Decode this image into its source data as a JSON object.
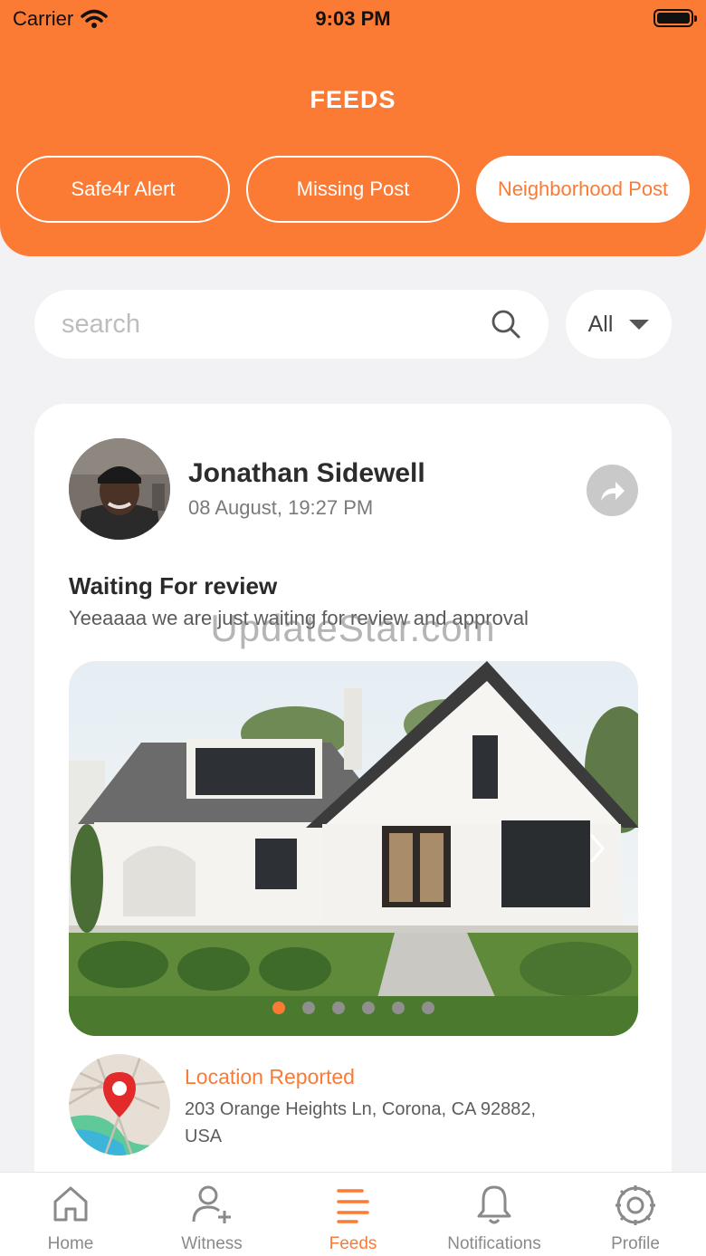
{
  "status_bar": {
    "carrier": "Carrier",
    "time": "9:03 PM"
  },
  "header": {
    "title": "FEEDS"
  },
  "tabs": [
    {
      "label": "Safe4r Alert",
      "active": false
    },
    {
      "label": "Missing Post",
      "active": false
    },
    {
      "label": "Neighborhood Post",
      "active": true
    }
  ],
  "search": {
    "placeholder": "search"
  },
  "filter": {
    "selected": "All"
  },
  "post": {
    "author": "Jonathan Sidewell",
    "date": "08 August, 19:27 PM",
    "title": "Waiting For review",
    "body": "Yeeaaaa we are just waiting for review and approval",
    "image_count": 6,
    "active_image_index": 0,
    "location_label": "Location Reported",
    "location_address": "203 Orange Heights Ln, Corona, CA 92882, USA"
  },
  "watermark": "UpdateStar.com",
  "colors": {
    "accent": "#fb7a34",
    "background": "#f2f2f4",
    "inactive": "#8a8a8a"
  },
  "tabbar": [
    {
      "label": "Home",
      "icon": "home-icon",
      "active": false
    },
    {
      "label": "Witness",
      "icon": "add-user-icon",
      "active": false
    },
    {
      "label": "Feeds",
      "icon": "feeds-list-icon",
      "active": true
    },
    {
      "label": "Notifications",
      "icon": "bell-icon",
      "active": false
    },
    {
      "label": "Profile",
      "icon": "gear-icon",
      "active": false
    }
  ]
}
